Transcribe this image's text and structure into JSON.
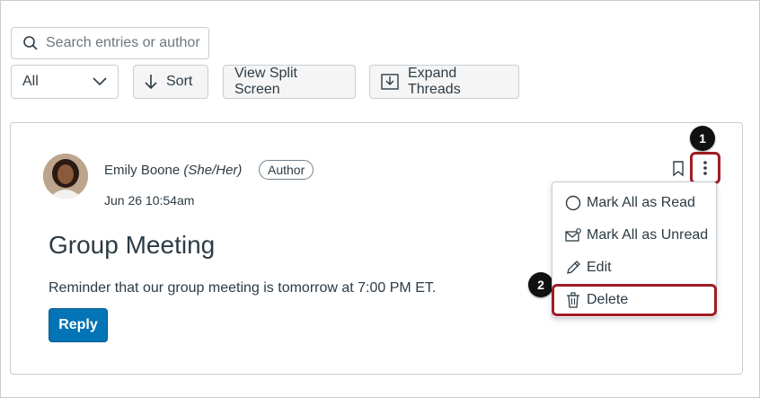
{
  "search": {
    "placeholder": "Search entries or author"
  },
  "toolbar": {
    "filter_value": "All",
    "sort_label": "Sort",
    "split_label": "View Split Screen",
    "expand_label": "Expand Threads"
  },
  "post": {
    "author_name": "Emily Boone",
    "pronouns": "(She/Her)",
    "role": "Author",
    "date": "Jun 26 10:54am",
    "title": "Group Meeting",
    "body": "Reminder that our group meeting is tomorrow at 7:00 PM ET.",
    "reply_label": "Reply"
  },
  "menu": {
    "items": [
      {
        "label": "Mark All as Read",
        "icon": "circle-icon"
      },
      {
        "label": "Mark All as Unread",
        "icon": "envelope-icon"
      },
      {
        "label": "Edit",
        "icon": "pencil-icon"
      },
      {
        "label": "Delete",
        "icon": "trash-icon"
      }
    ]
  },
  "callouts": {
    "first": "1",
    "second": "2"
  },
  "colors": {
    "accent": "#0374b5",
    "highlight": "#9f1d25",
    "text": "#2d3b45",
    "border": "#c7cdd1"
  }
}
